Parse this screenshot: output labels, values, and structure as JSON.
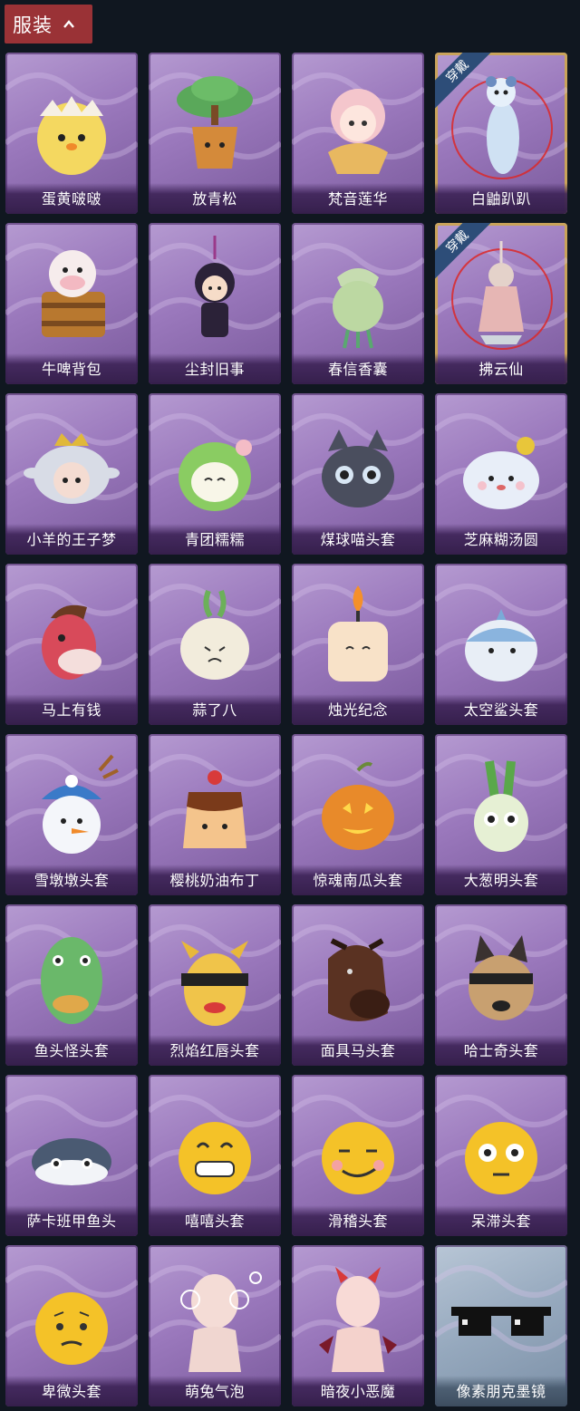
{
  "header": {
    "title": "服装"
  },
  "items": [
    {
      "name": "蛋黄啵啵",
      "icon": "chick-egg-icon",
      "equipped": false,
      "special": false
    },
    {
      "name": "放青松",
      "icon": "bonsai-pine-icon",
      "equipped": false,
      "special": false
    },
    {
      "name": "梵音莲华",
      "icon": "lotus-character-icon",
      "equipped": false,
      "special": false
    },
    {
      "name": "白鼬趴趴",
      "icon": "white-ferret-icon",
      "equipped": true,
      "badge": "穿戴",
      "special": false
    },
    {
      "name": "牛啤背包",
      "icon": "cow-beer-backpack-icon",
      "equipped": false,
      "special": false
    },
    {
      "name": "尘封旧事",
      "icon": "chibi-figure-keychain-icon",
      "equipped": false,
      "special": false
    },
    {
      "name": "春信香囊",
      "icon": "scent-sachet-icon",
      "equipped": false,
      "special": false
    },
    {
      "name": "拂云仙",
      "icon": "cloud-immortal-charm-icon",
      "equipped": true,
      "badge": "穿戴",
      "special": false
    },
    {
      "name": "小羊的王子梦",
      "icon": "sheep-prince-icon",
      "equipped": false,
      "special": false
    },
    {
      "name": "青团糯糯",
      "icon": "green-rice-ball-icon",
      "equipped": false,
      "special": false
    },
    {
      "name": "煤球喵头套",
      "icon": "black-cat-head-icon",
      "equipped": false,
      "special": false
    },
    {
      "name": "芝麻糊汤圆",
      "icon": "dumpling-head-icon",
      "equipped": false,
      "special": false
    },
    {
      "name": "马上有钱",
      "icon": "red-horse-head-icon",
      "equipped": false,
      "special": false
    },
    {
      "name": "蒜了八",
      "icon": "garlic-head-icon",
      "equipped": false,
      "special": false
    },
    {
      "name": "烛光纪念",
      "icon": "candle-head-icon",
      "equipped": false,
      "special": false
    },
    {
      "name": "太空鲨头套",
      "icon": "shark-head-icon",
      "equipped": false,
      "special": false
    },
    {
      "name": "雪墩墩头套",
      "icon": "snowman-head-icon",
      "equipped": false,
      "special": false
    },
    {
      "name": "樱桃奶油布丁",
      "icon": "pudding-head-icon",
      "equipped": false,
      "special": false
    },
    {
      "name": "惊魂南瓜头套",
      "icon": "pumpkin-head-icon",
      "equipped": false,
      "special": false
    },
    {
      "name": "大葱明头套",
      "icon": "green-onion-head-icon",
      "equipped": false,
      "special": false
    },
    {
      "name": "鱼头怪头套",
      "icon": "fish-head-icon",
      "equipped": false,
      "special": false
    },
    {
      "name": "烈焰红唇头套",
      "icon": "yellow-sunglasses-head-icon",
      "equipped": false,
      "special": false
    },
    {
      "name": "面具马头套",
      "icon": "horse-mask-icon",
      "equipped": false,
      "special": false
    },
    {
      "name": "哈士奇头套",
      "icon": "husky-head-icon",
      "equipped": false,
      "special": false
    },
    {
      "name": "萨卡班甲鱼头",
      "icon": "sacabambaspis-head-icon",
      "equipped": false,
      "special": false
    },
    {
      "name": "嘻嘻头套",
      "icon": "grin-emoji-head-icon",
      "equipped": false,
      "special": false
    },
    {
      "name": "滑稽头套",
      "icon": "smirk-emoji-head-icon",
      "equipped": false,
      "special": false
    },
    {
      "name": "呆滞头套",
      "icon": "stare-emoji-head-icon",
      "equipped": false,
      "special": false
    },
    {
      "name": "卑微头套",
      "icon": "humble-emoji-head-icon",
      "equipped": false,
      "special": false
    },
    {
      "name": "萌兔气泡",
      "icon": "bunny-bubble-icon",
      "equipped": false,
      "special": false
    },
    {
      "name": "暗夜小恶魔",
      "icon": "little-devil-icon",
      "equipped": false,
      "special": false
    },
    {
      "name": "像素朋克墨镜",
      "icon": "pixel-sunglasses-icon",
      "equipped": false,
      "special": true
    }
  ],
  "colors": {
    "background": "#101720",
    "header": "#9a3236",
    "card": "#9a78bc",
    "equipped_border": "#c9a35a",
    "badge": "#2d4d78"
  }
}
